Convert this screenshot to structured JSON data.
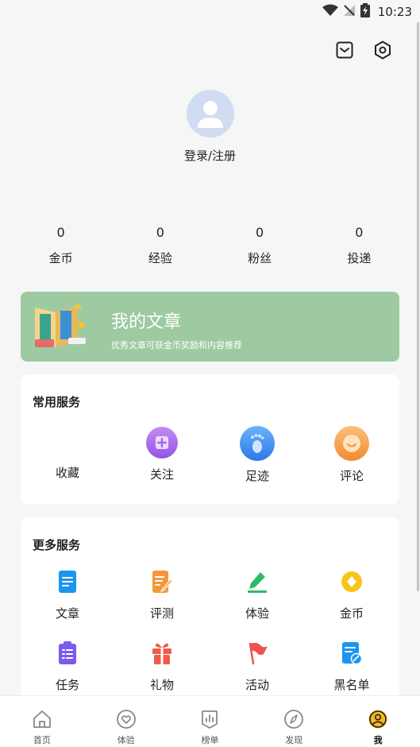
{
  "status_bar": {
    "time": "10:23"
  },
  "profile": {
    "login_label": "登录/注册"
  },
  "stats": [
    {
      "value": "0",
      "label": "金币"
    },
    {
      "value": "0",
      "label": "经验"
    },
    {
      "value": "0",
      "label": "粉丝"
    },
    {
      "value": "0",
      "label": "投递"
    }
  ],
  "banner": {
    "title": "我的文章",
    "subtitle": "优秀文章可获金币奖励和内容推荐",
    "color": "#9ecaa2"
  },
  "common_services": {
    "title": "常用服务",
    "items": [
      {
        "label": "收藏",
        "icon": "star-icon"
      },
      {
        "label": "关注",
        "icon": "plus-icon",
        "color": "#a766e6"
      },
      {
        "label": "足迹",
        "icon": "footprint-icon",
        "color": "#3d8bef"
      },
      {
        "label": "评论",
        "icon": "comment-icon",
        "color": "#f5963a"
      }
    ]
  },
  "more_services": {
    "title": "更多服务",
    "items": [
      {
        "label": "文章",
        "icon": "document-icon",
        "color": "#1a96f0"
      },
      {
        "label": "评测",
        "icon": "review-icon",
        "color": "#f5963a"
      },
      {
        "label": "体验",
        "icon": "pen-icon",
        "color": "#2dbb69"
      },
      {
        "label": "金币",
        "icon": "coin-icon",
        "color": "#f7c51a"
      },
      {
        "label": "任务",
        "icon": "task-icon",
        "color": "#7c5af2"
      },
      {
        "label": "礼物",
        "icon": "gift-icon",
        "color": "#ee5c4b"
      },
      {
        "label": "活动",
        "icon": "flag-icon",
        "color": "#ef5350"
      },
      {
        "label": "黑名单",
        "icon": "blacklist-icon",
        "color": "#1a96f0"
      }
    ]
  },
  "bottom_nav": [
    {
      "label": "首页",
      "icon": "home-icon"
    },
    {
      "label": "体验",
      "icon": "heart-icon"
    },
    {
      "label": "榜单",
      "icon": "ranking-icon"
    },
    {
      "label": "发现",
      "icon": "compass-icon"
    },
    {
      "label": "我",
      "icon": "user-icon",
      "active": true
    }
  ]
}
